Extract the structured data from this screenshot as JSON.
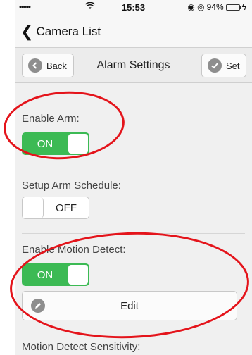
{
  "statusbar": {
    "signal": "•••••",
    "wifi": "≀",
    "time": "15:53",
    "icons": "◉ ◎",
    "battery_text": "94%",
    "battery_level": 0.94,
    "charge_icon": "ϟ"
  },
  "nav": {
    "back_chevron": "❮",
    "title": "Camera List"
  },
  "toolbar": {
    "back_label": "Back",
    "title": "Alarm Settings",
    "set_label": "Set"
  },
  "settings": {
    "enable_arm": {
      "label": "Enable Arm:",
      "state": "ON"
    },
    "arm_schedule": {
      "label": "Setup Arm Schedule:",
      "state": "OFF"
    },
    "motion_detect": {
      "label": "Enable Motion Detect:",
      "state": "ON",
      "edit_label": "Edit"
    },
    "sensitivity": {
      "label": "Motion Detect Sensitivity:"
    }
  },
  "colors": {
    "toggle_on": "#3cba54",
    "annotation": "#e4141b"
  }
}
